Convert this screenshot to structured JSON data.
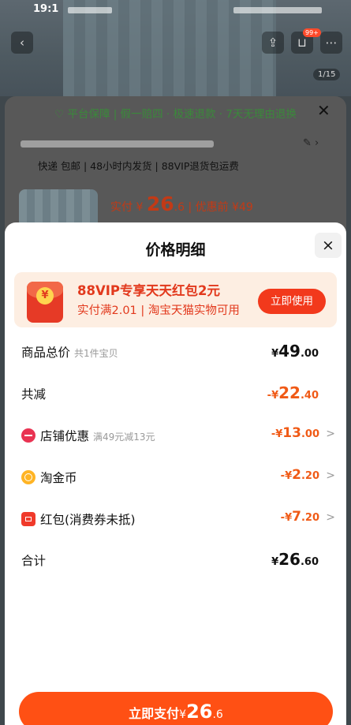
{
  "status_bar": {
    "time": "19:1"
  },
  "product_page": {
    "image_index": "1/15",
    "cart_badge": "99+",
    "guarantee": "♡ 平台保障 | 假一赔四 · 极速退款 · 7天无理由退换",
    "delivery": "快递 包邮 | 48小时内发货 | 88VIP退货包运费",
    "sku_price_prefix": "实付",
    "sku_price_currency": "¥",
    "sku_price_int": "26",
    "sku_price_dec": ".6",
    "sku_price_before": "| 优惠前 ¥49"
  },
  "panel": {
    "title": "价格明细",
    "close_label": "×"
  },
  "vip_banner": {
    "coin": "¥",
    "title": "88VIP专享天天红包2元",
    "subtitle": "实付满2.01 | 淘宝天猫实物可用",
    "button": "立即使用"
  },
  "rows": {
    "total_goods": {
      "label": "商品总价",
      "note": "共1件宝贝",
      "currency": "¥",
      "int": "49",
      "dec": ".00"
    },
    "total_discount": {
      "label": "共减",
      "prefix": "-",
      "currency": "¥",
      "int": "22",
      "dec": ".40"
    },
    "shop_discount": {
      "label": "店铺优惠",
      "note": "满49元减13元",
      "prefix": "-",
      "currency": "¥",
      "int": "13",
      "dec": ".00",
      "chevron": ">"
    },
    "taojinbi": {
      "label": "淘金币",
      "prefix": "-",
      "currency": "¥",
      "int": "2",
      "dec": ".20",
      "chevron": ">"
    },
    "red_packet": {
      "label": "红包(消费券未抵)",
      "prefix": "-",
      "currency": "¥",
      "int": "7",
      "dec": ".20",
      "chevron": ">"
    },
    "grand_total": {
      "label": "合计",
      "currency": "¥",
      "int": "26",
      "dec": ".60"
    }
  },
  "pay_button": {
    "label": "立即支付",
    "currency": "¥",
    "int": "26",
    "dec": ".6"
  },
  "colors": {
    "accent": "#ff5014",
    "vip_red": "#e2391d",
    "discount_orange": "#f05a16"
  }
}
